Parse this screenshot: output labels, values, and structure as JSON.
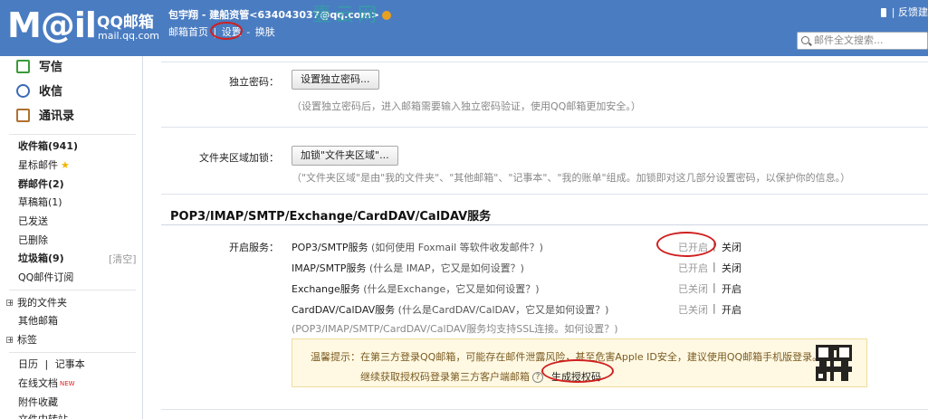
{
  "header": {
    "logo_text": "M@il",
    "logo_brand": "QQ邮箱",
    "logo_url": "mail.qq.com",
    "user": "包宇翔 - 建船资管<634043037@qq.com>",
    "watermark": "壹云网",
    "nav": {
      "home": "邮箱首页",
      "sep1": "|",
      "settings": "设置",
      "sep2": "-",
      "skin": "换肤"
    },
    "feedback": "| 反馈建",
    "search_placeholder": "邮件全文搜索..."
  },
  "sidebar": {
    "quick": {
      "write": "写信",
      "inbox": "收信",
      "contacts": "通讯录"
    },
    "folders": {
      "inbox": "收件箱(941)",
      "starred": "星标邮件",
      "group": "群邮件(2)",
      "drafts": "草稿箱(1)",
      "sent": "已发送",
      "deleted": "已删除",
      "junk": "垃圾箱(9)",
      "junk_clear": "[清空]",
      "subscription": "QQ邮件订阅"
    },
    "tree": {
      "my_folders": "我的文件夹",
      "other": "其他邮箱",
      "tags": "标签",
      "plus": "⊞"
    },
    "tools": {
      "calendar": "日历",
      "sep": "|",
      "notebook": "记事本",
      "online_docs": "在线文档",
      "new_tag": "NEW",
      "attachments": "附件收藏",
      "file_transfer": "文件中转站"
    }
  },
  "main": {
    "indep_pwd": {
      "label": "独立密码：",
      "button": "设置独立密码...",
      "hint": "（设置独立密码后，进入邮箱需要输入独立密码验证，使用QQ邮箱更加安全。）"
    },
    "folder_lock": {
      "label": "文件夹区域加锁：",
      "button": "加锁\"文件夹区域\"...",
      "hint": "（\"文件夹区域\"是由\"我的文件夹\"、\"其他邮箱\"、\"记事本\"、\"我的账单\"组成。加锁即对这几部分设置密码，以保护你的信息。）"
    },
    "section_title": "POP3/IMAP/SMTP/Exchange/CardDAV/CalDAV服务",
    "open_service_label": "开启服务：",
    "services": [
      {
        "name": "POP3/SMTP服务",
        "help": "(如何使用 Foxmail 等软件收发邮件？)",
        "state": "已开启",
        "action": "关闭"
      },
      {
        "name": "IMAP/SMTP服务",
        "help": "(什么是 IMAP，它又是如何设置？)",
        "state": "已开启",
        "action": "关闭"
      },
      {
        "name": "Exchange服务",
        "help": "(什么是Exchange，它又是如何设置？)",
        "state": "已关闭",
        "action": "开启"
      },
      {
        "name": "CardDAV/CalDAV服务",
        "help": "(什么是CardDAV/CalDAV，它又是如何设置？)",
        "state": "已关闭",
        "action": "开启"
      }
    ],
    "pipe": "|",
    "ssl_note": "(POP3/IMAP/SMTP/CardDAV/CalDAV服务均支持SSL连接。如何设置？)",
    "tip": {
      "line1": "温馨提示：在第三方登录QQ邮箱，可能存在邮件泄露风险，甚至危害Apple ID安全，建议使用QQ邮箱手机版登录。",
      "line2": "继续获取授权码登录第三方客户端邮箱",
      "help": "?",
      "auth_link": "生成授权码"
    }
  }
}
